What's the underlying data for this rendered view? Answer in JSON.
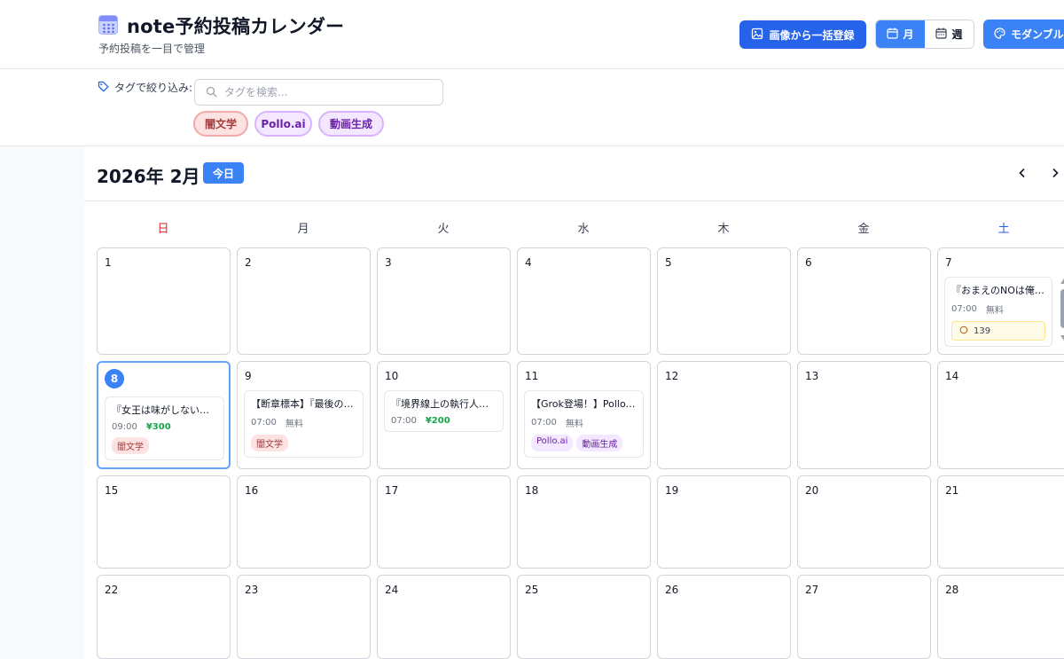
{
  "header": {
    "title": "note予約投稿カレンダー",
    "subtitle": "予約投稿を一目で管理",
    "import_button": "画像から一括登録",
    "view_month": "月",
    "view_week": "週",
    "theme_button": "モダンブルー"
  },
  "filter": {
    "label": "タグで絞り込み:",
    "search_placeholder": "タグを検索...",
    "tags": [
      "闇文学",
      "Pollo.ai",
      "動画生成"
    ]
  },
  "calendar": {
    "month_title": "2026年 2月",
    "today_label": "今日",
    "weekdays": [
      "日",
      "月",
      "火",
      "水",
      "木",
      "金",
      "土"
    ],
    "days": [
      "1",
      "2",
      "3",
      "4",
      "5",
      "6",
      "7",
      "8",
      "9",
      "10",
      "11",
      "12",
      "13",
      "14",
      "15",
      "16",
      "17",
      "18",
      "19",
      "20",
      "21",
      "22",
      "23",
      "24",
      "25",
      "26",
      "27",
      "28"
    ],
    "events": {
      "d7": {
        "title": "『おまえのNOは俺のYE…",
        "time": "07:00",
        "price": "無料",
        "count": "139"
      },
      "d8": {
        "title": "『女王は味がしない』｜夏…",
        "time": "09:00",
        "price": "¥300",
        "tags": [
          "闇文学"
        ]
      },
      "d9": {
        "title": "【断章標本】『最後の手紙…",
        "time": "07:00",
        "price": "無料",
        "tags": [
          "闇文学"
        ]
      },
      "d10": {
        "title": "『境界線上の執行人』二…",
        "time": "07:00",
        "price": "¥200"
      },
      "d11": {
        "title": "【Grok登場！】Pollo.ai×…",
        "time": "07:00",
        "price": "無料",
        "tags": [
          "Pollo.ai",
          "動画生成"
        ]
      }
    }
  },
  "colors": {
    "primary": "#2563eb",
    "accent": "#3b82f6",
    "sunday": "#dc2626",
    "saturday": "#2563eb",
    "paid_price": "#16a34a"
  },
  "icons": {
    "app": "calendar-app-icon",
    "import": "image-import-icon",
    "month": "calendar-icon",
    "week": "calendar-week-icon",
    "theme": "palette-icon",
    "filter": "tag-icon",
    "search": "search-icon",
    "prev": "chevron-left-icon",
    "next": "chevron-right-icon",
    "counter": "comment-icon"
  }
}
